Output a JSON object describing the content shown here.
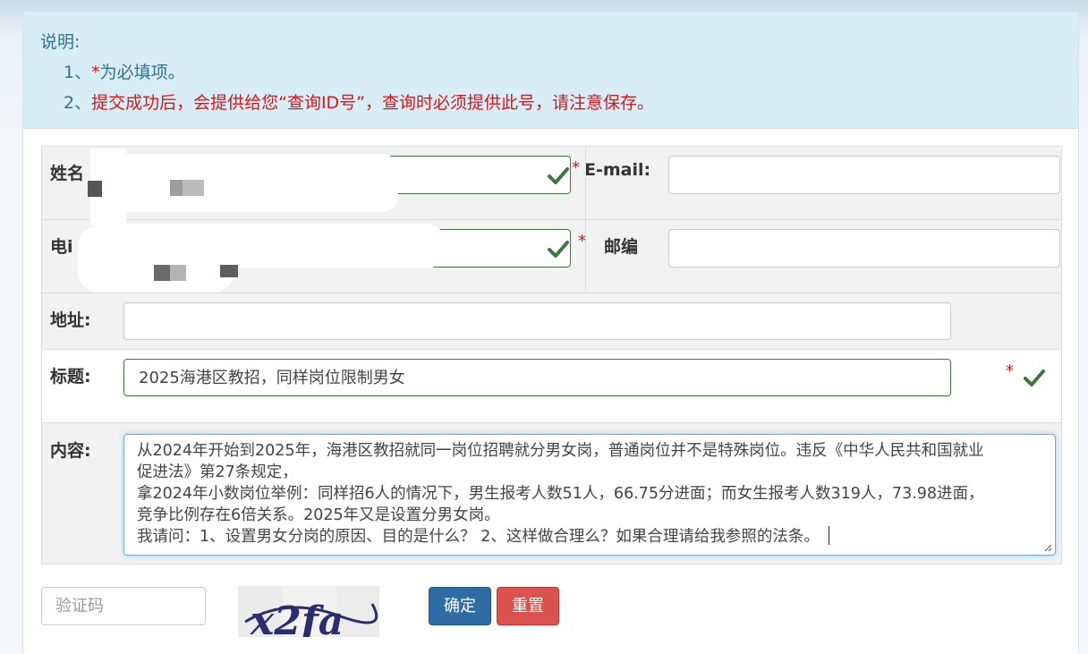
{
  "notice": {
    "heading": "说明:",
    "item1_num": "1、",
    "item1_star": "*",
    "item1_text": "为必填项。",
    "item2_num": "2、",
    "item2_text": "提交成功后，会提供给您“查询ID号”，查询时必须提供此号，请注意保存。"
  },
  "form": {
    "name_label": "姓名",
    "name_value": "",
    "email_label": "E-mail:",
    "email_value": "",
    "phone_label": "电i",
    "phone_value": "",
    "zip_label": "邮编",
    "zip_value": "",
    "address_label": "地址:",
    "address_value": "",
    "title_label": "标题:",
    "title_value": "2025海港区教招，同样岗位限制男女",
    "content_label": "内容:",
    "content_lines": [
      "从2024年开始到2025年，海港区教招就同一岗位招聘就分男女岗，普通岗位并不是特殊岗位。违反《中华人民共和国就业",
      "促进法》第27条规定，",
      "拿2024年小数岗位举例：同样招6人的情况下，男生报考人数51人，66.75分进面；而女生报考人数319人，73.98进面，",
      "竞争比例存在6倍关系。2025年又是设置分男女岗。",
      "我请问：1、设置男女分岗的原因、目的是什么？ 2、这样做合理么？如果合理请给我参照的法条。"
    ],
    "required_mark": "*"
  },
  "captcha": {
    "placeholder": "验证码",
    "image_text": "x2fa"
  },
  "buttons": {
    "confirm": "确定",
    "reset": "重置"
  },
  "colors": {
    "notice_bg": "#d9edf7",
    "notice_text": "#31708f",
    "required": "#d9161a",
    "valid": "#3c763d",
    "primary": "#2e6da4",
    "danger": "#d9534f"
  }
}
